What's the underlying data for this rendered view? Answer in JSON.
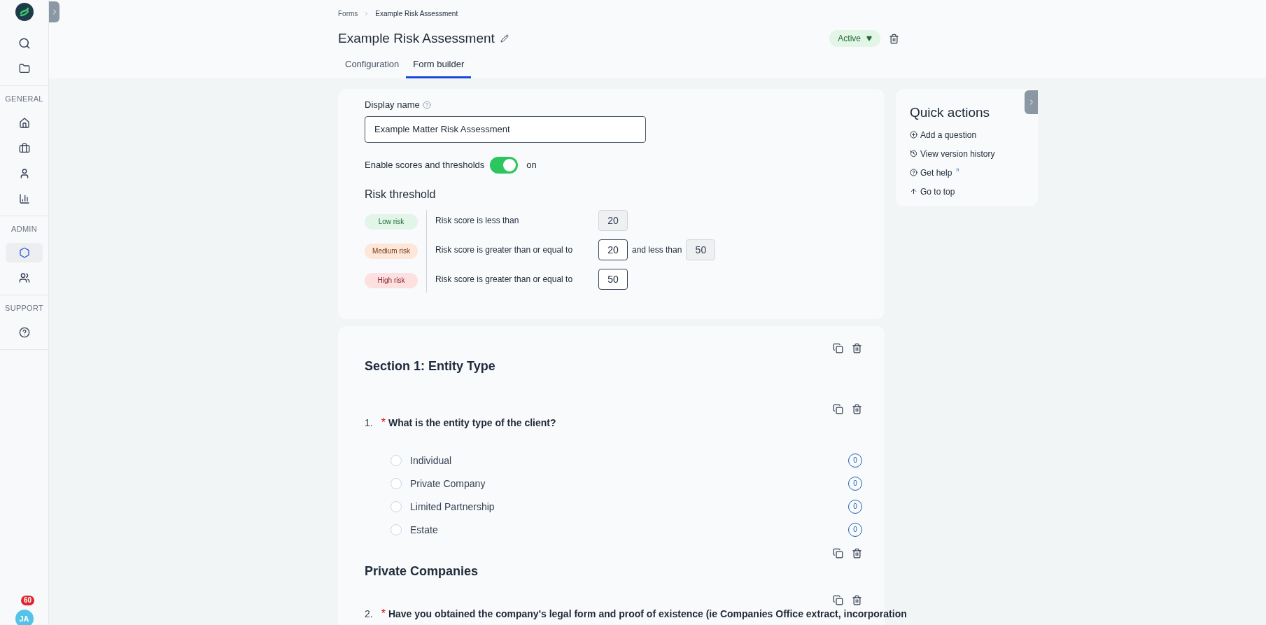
{
  "sidebar": {
    "groups": [
      {
        "items": [
          {
            "kind": "search",
            "selected": false
          },
          {
            "kind": "folder",
            "selected": false
          }
        ]
      },
      {
        "label": "GENERAL",
        "items": [
          {
            "kind": "home",
            "selected": false
          },
          {
            "kind": "briefcase",
            "selected": false
          },
          {
            "kind": "person",
            "selected": false
          },
          {
            "kind": "chart",
            "selected": false
          }
        ]
      },
      {
        "label": "ADMIN",
        "items": [
          {
            "kind": "settings",
            "selected": true
          },
          {
            "kind": "people",
            "selected": false
          }
        ]
      },
      {
        "label": "SUPPORT",
        "items": [
          {
            "kind": "help",
            "selected": false
          }
        ]
      }
    ],
    "avatar": {
      "initials": "JA",
      "badge": "60"
    }
  },
  "breadcrumbs": [
    "Forms",
    "Example Risk Assessment"
  ],
  "title": "Example Risk Assessment",
  "required_mark": "*",
  "status": "Active",
  "tabs": [
    {
      "label": "Configuration",
      "selected": false
    },
    {
      "label": "Form builder",
      "selected": true
    }
  ],
  "settings": {
    "display_name": {
      "label": "Display name",
      "value": "Example Matter Risk Assessment"
    },
    "toggle": {
      "label": "Enable scores and thresholds",
      "on": true,
      "state_text": "on"
    },
    "risk_threshold": {
      "title": "Risk threshold",
      "rows": [
        {
          "badge": "Low risk",
          "color": "#e3f5e8",
          "text": "Risk score is less than",
          "fields": [
            {
              "value": "20",
              "disabled": true
            }
          ]
        },
        {
          "badge": "Medium risk",
          "color": "#fde6da",
          "text": "Risk score is greater than or equal to",
          "fields": [
            {
              "value": "20",
              "disabled": false
            }
          ],
          "and_text": "and less than",
          "upper": {
            "value": "50",
            "disabled": true
          }
        },
        {
          "badge": "High risk",
          "color": "#fde1e1",
          "text": "Risk score is greater than or equal to",
          "fields": [
            {
              "value": "50",
              "disabled": false
            }
          ]
        }
      ]
    }
  },
  "blocks": [
    {
      "kind": "section",
      "title": "Section 1: Entity Type"
    },
    {
      "kind": "question",
      "number": "1.",
      "required": true,
      "text": "What is the entity type of the client?",
      "options": [
        {
          "label": "Individual",
          "score": "0",
          "selected": false
        },
        {
          "label": "Private Company",
          "score": "0",
          "selected": false
        },
        {
          "label": "Limited Partnership",
          "score": "0",
          "selected": false
        },
        {
          "label": "Estate",
          "score": "0",
          "selected": false
        }
      ]
    },
    {
      "kind": "section",
      "title": "Private Companies"
    },
    {
      "kind": "question",
      "number": "2.",
      "required": true,
      "text": "Have you obtained the company's legal form and proof of existence (ie Companies Office extract, incorporation"
    }
  ],
  "quick_actions": {
    "title": "Quick actions",
    "items": [
      {
        "kind": "add",
        "label": "Add a question",
        "external": false
      },
      {
        "kind": "history",
        "label": "View version history",
        "external": false
      },
      {
        "kind": "help",
        "label": "Get help",
        "external": true
      },
      {
        "kind": "up",
        "label": "Go to top",
        "external": false
      }
    ]
  }
}
